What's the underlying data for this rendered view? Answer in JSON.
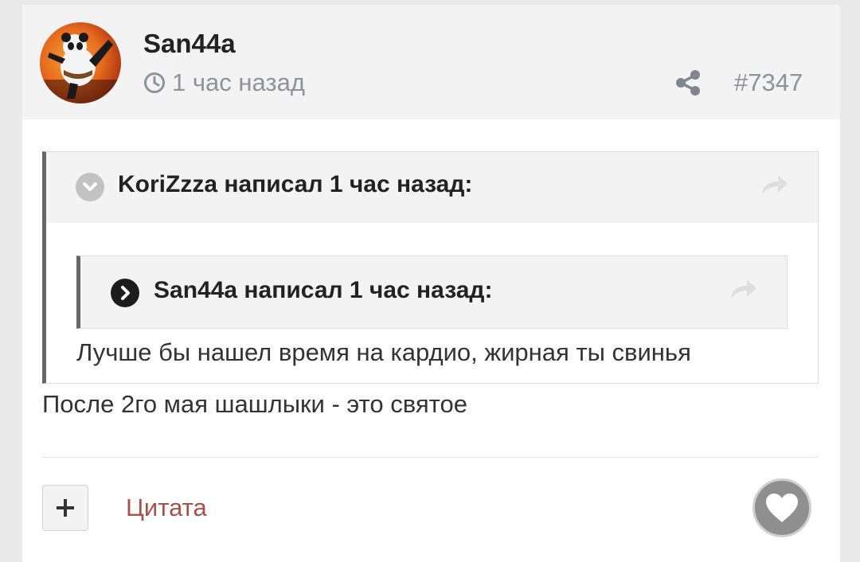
{
  "post": {
    "author": "San44a",
    "time": "1 час назад",
    "number": "#7347",
    "text": "После 2го мая шашлыки - это святое"
  },
  "quote_outer": {
    "title": "KoriZzza написал 1 час назад:",
    "text": "Лучше бы нашел время на кардио, жирная ты свинья"
  },
  "quote_inner": {
    "title": "San44a написал 1 час назад:"
  },
  "actions": {
    "quote_label": "Цитата"
  },
  "icons": {
    "time": "clock-icon",
    "share": "share-icon",
    "collapse_outer": "chevron-down-icon",
    "expand_inner": "chevron-right-icon",
    "reply": "reply-arrow-icon",
    "plus": "plus-icon",
    "like": "heart-icon"
  },
  "colors": {
    "header_bg": "#f3f3f3",
    "muted_text": "#8c939b",
    "quote_link": "#a6514a",
    "like_bg": "#8f8f8f"
  }
}
